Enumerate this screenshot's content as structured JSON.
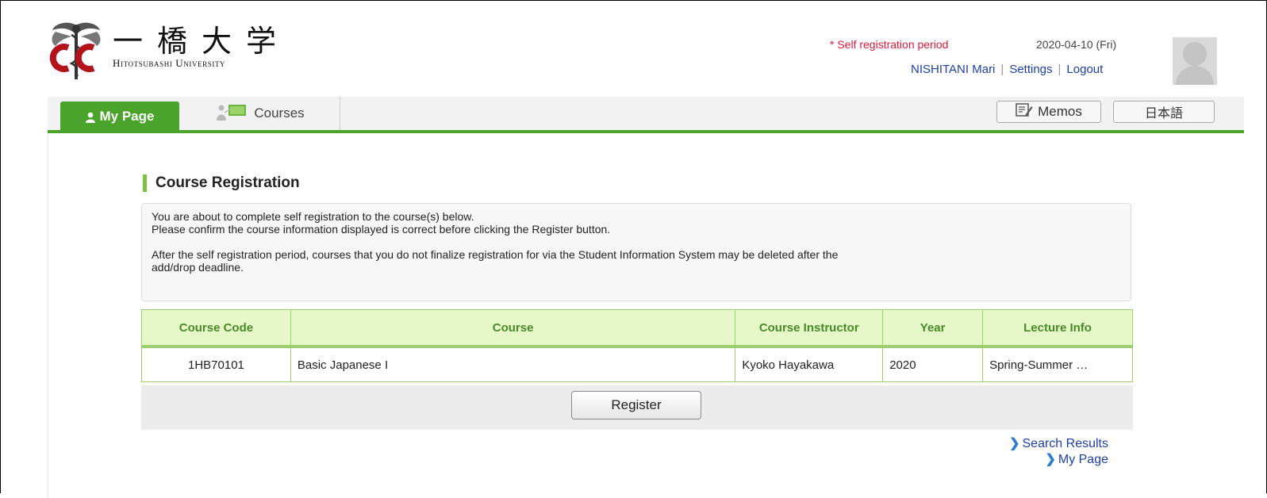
{
  "header": {
    "logo_kanji": "一橋大学",
    "logo_english": "Hitotsubashi University",
    "period_notice": "* Self registration period",
    "date": "2020-04-10 (Fri)",
    "user_name": "NISHITANI Mari",
    "settings_label": "Settings",
    "logout_label": "Logout"
  },
  "nav": {
    "tabs": [
      {
        "label": "My Page",
        "icon": "person-icon",
        "active": true
      },
      {
        "label": "Courses",
        "icon": "courses-icon",
        "active": false
      }
    ],
    "memos_label": "Memos",
    "language_label": "日本語"
  },
  "section": {
    "title": "Course Registration"
  },
  "notice": {
    "line1": "You are about to complete self registration to the course(s) below.",
    "line2": "Please confirm the course information displayed is correct before clicking the Register button.",
    "line3": "After the self registration period, courses that you do not finalize registration for via the Student Information System may be deleted after the",
    "line4": "add/drop deadline."
  },
  "table": {
    "headers": [
      "Course Code",
      "Course",
      "Course Instructor",
      "Year",
      "Lecture Info"
    ],
    "rows": [
      [
        "1HB70101",
        "Basic Japanese I",
        "Kyoko Hayakawa",
        "2020",
        "Spring-Summer …"
      ]
    ]
  },
  "actions": {
    "register_label": "Register"
  },
  "links": {
    "search_results": "Search Results",
    "my_page": "My Page"
  },
  "colors": {
    "accent_green": "#4aa32a",
    "header_green_bg": "#e6f7c8",
    "alert_red": "#e0193b",
    "link_blue": "#1e3fa8"
  }
}
